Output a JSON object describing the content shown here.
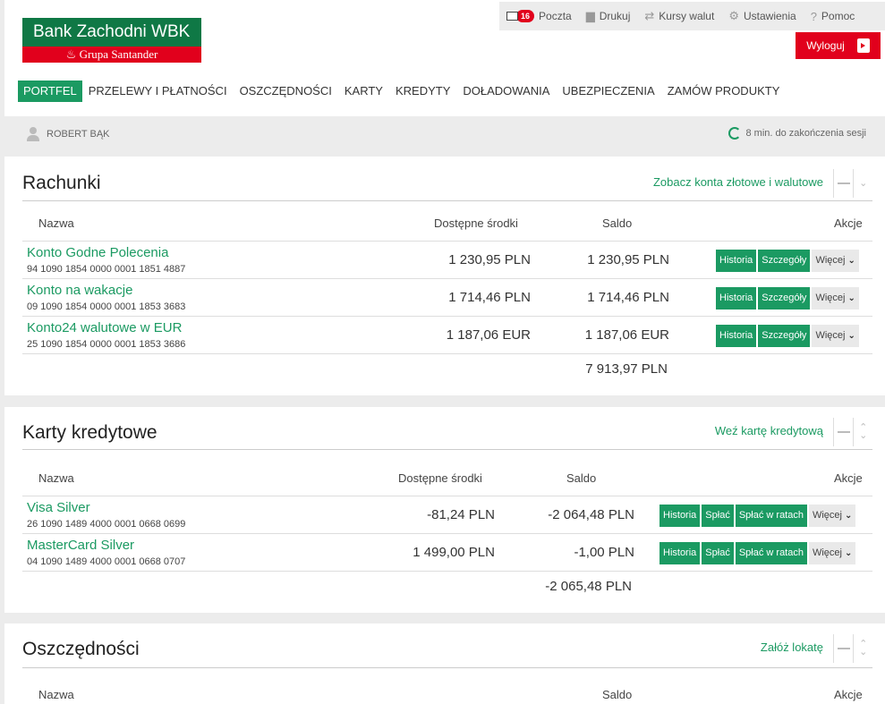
{
  "brand": {
    "name": "Bank Zachodni WBK",
    "sub": "Grupa Santander"
  },
  "toolbar": {
    "mail_label": "Poczta",
    "mail_count": "16",
    "print_label": "Drukuj",
    "rates_label": "Kursy walut",
    "settings_label": "Ustawienia",
    "help_label": "Pomoc",
    "logout_label": "Wyloguj"
  },
  "nav": [
    "PORTFEL",
    "PRZELEWY I PŁATNOŚCI",
    "OSZCZĘDNOŚCI",
    "KARTY",
    "KREDYTY",
    "DOŁADOWANIA",
    "UBEZPIECZENIA",
    "ZAMÓW PRODUKTY"
  ],
  "user": {
    "name": "ROBERT BĄK",
    "session": "8 min. do zakończenia sesji"
  },
  "accounts": {
    "title": "Rachunki",
    "link": "Zobacz konta złotowe i walutowe",
    "cols": {
      "name": "Nazwa",
      "available": "Dostępne środki",
      "balance": "Saldo",
      "actions": "Akcje"
    },
    "rows": [
      {
        "name": "Konto Godne Polecenia",
        "number": "94 1090 1854 0000 0001 1851 4887",
        "available": "1 230,95 PLN",
        "balance": "1 230,95 PLN"
      },
      {
        "name": "Konto na wakacje",
        "number": "09 1090 1854 0000 0001 1853 3683",
        "available": "1 714,46 PLN",
        "balance": "1 714,46 PLN"
      },
      {
        "name": "Konto24 walutowe w EUR",
        "number": "25 1090 1854 0000 0001 1853 3686",
        "available": "1 187,06 EUR",
        "balance": "1 187,06 EUR"
      }
    ],
    "buttons": {
      "history": "Historia",
      "details": "Szczegóły",
      "more": "Więcej"
    },
    "total": "7 913,97 PLN"
  },
  "cards": {
    "title": "Karty kredytowe",
    "link": "Weź kartę kredytową",
    "cols": {
      "name": "Nazwa",
      "available": "Dostępne środki",
      "balance": "Saldo",
      "actions": "Akcje"
    },
    "rows": [
      {
        "name": "Visa Silver",
        "number": "26 1090 1489 4000 0001 0668 0699",
        "available": "-81,24 PLN",
        "balance": "-2 064,48 PLN"
      },
      {
        "name": "MasterCard Silver",
        "number": "04 1090 1489 4000 0001 0668 0707",
        "available": "1 499,00 PLN",
        "balance": "-1,00 PLN"
      }
    ],
    "buttons": {
      "history": "Historia",
      "pay": "Spłać",
      "installments": "Spłać w ratach",
      "more": "Więcej"
    },
    "total": "-2 065,48 PLN"
  },
  "savings": {
    "title": "Oszczędności",
    "link": "Załóż lokatę",
    "cols": {
      "name": "Nazwa",
      "balance": "Saldo",
      "actions": "Akcje"
    }
  },
  "colors": {
    "brand_green": "#0f7845",
    "accent_green": "#1b9a62",
    "red": "#e1001c"
  }
}
